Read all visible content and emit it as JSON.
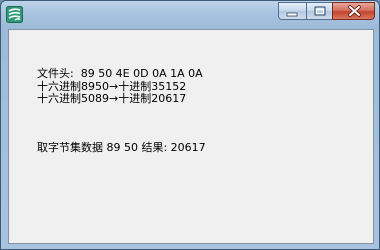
{
  "window": {
    "icon": "app-stripes-icon",
    "minimize_icon": "minimize-icon",
    "maximize_icon": "maximize-icon",
    "close_icon": "close-icon"
  },
  "content": {
    "file_header": "文件头:  89 50 4E 0D 0A 1A 0A",
    "hex_to_dec_1": "十六进制8950→十进制35152",
    "hex_to_dec_2": "十六进制5089→十进制20617",
    "byte_result": "取字节集数据 89 50 结果: 20617"
  }
}
